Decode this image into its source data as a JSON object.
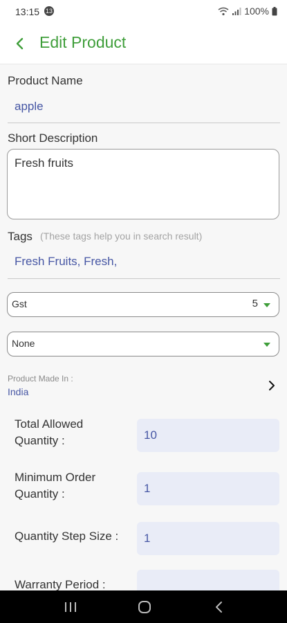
{
  "status_bar": {
    "time": "13:15",
    "notification_badge": "13",
    "battery": "100%"
  },
  "header": {
    "title": "Edit Product"
  },
  "product_name": {
    "label": "Product Name",
    "value": "apple"
  },
  "short_description": {
    "label": "Short Description",
    "value": "Fresh fruits"
  },
  "tags": {
    "label": "Tags",
    "hint": "(These tags help you in search result)",
    "value": "Fresh Fruits, Fresh,"
  },
  "gst_select": {
    "label": "Gst",
    "value": "5"
  },
  "category_select": {
    "value": "None"
  },
  "made_in": {
    "label": "Product Made In :",
    "value": "India"
  },
  "total_allowed_quantity": {
    "label_line1": "Total Allowed",
    "label_line2": "Quantity :",
    "value": "10"
  },
  "minimum_order_quantity": {
    "label_line1": "Minimum Order",
    "label_line2": "Quantity :",
    "value": "1"
  },
  "quantity_step_size": {
    "label": "Quantity Step Size :",
    "value": "1"
  },
  "warranty_period": {
    "label": "Warranty Period :",
    "value": ""
  },
  "colors": {
    "accent": "#3f9e3a",
    "value_text": "#4656a4",
    "input_fill": "#e9ecf7"
  },
  "icons": {
    "back": "back-arrow-icon",
    "dropdown": "caret-down-icon",
    "chevron": "chevron-right-icon"
  }
}
